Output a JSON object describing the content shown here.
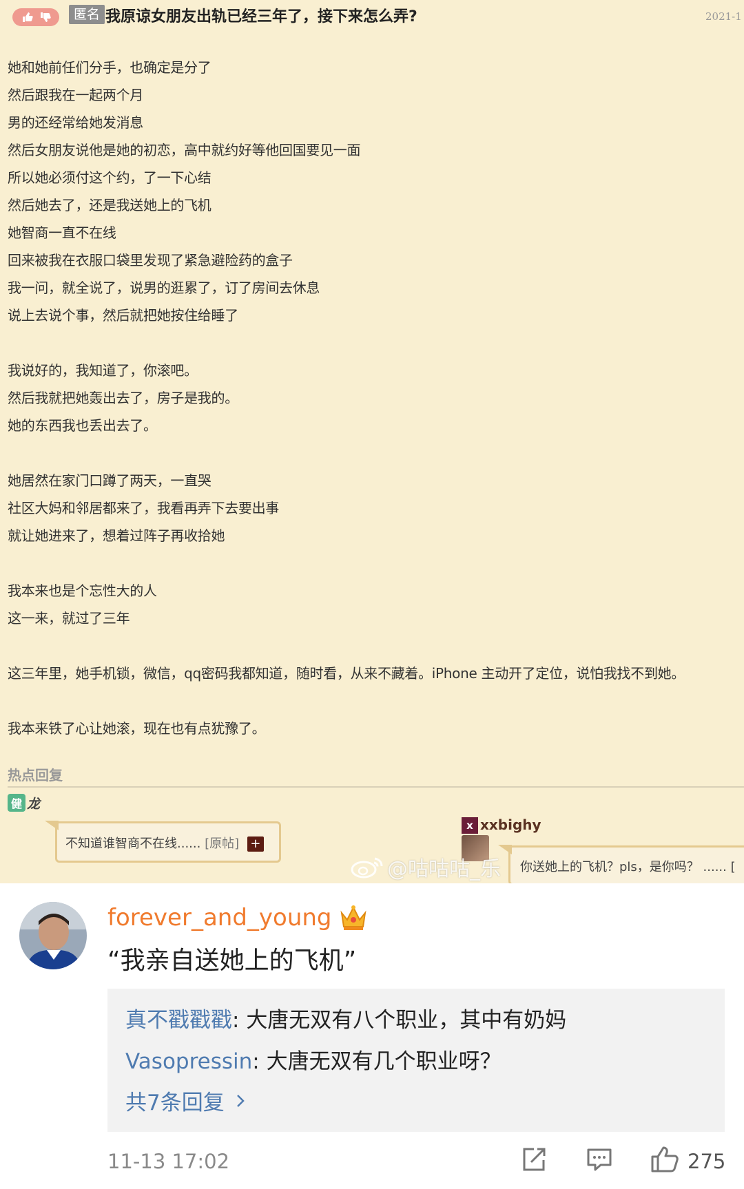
{
  "post": {
    "anon_tag": "匿名",
    "title": "我原谅女朋友出轨已经三年了，接下来怎么弄?",
    "date": "2021-1",
    "lines": [
      "她和她前任们分手，也确定是分了",
      "然后跟我在一起两个月",
      "男的还经常给她发消息",
      "然后女朋友说他是她的初恋，高中就约好等他回国要见一面",
      "所以她必须付这个约，了一下心结",
      "然后她去了，还是我送她上的飞机",
      "她智商一直不在线",
      "回来被我在衣服口袋里发现了紧急避险药的盒子",
      "我一问，就全说了，说男的逛累了，订了房间去休息",
      "说上去说个事，然后就把她按住给睡了",
      "",
      "我说好的，我知道了，你滚吧。",
      "然后我就把她轰出去了，房子是我的。",
      "她的东西我也丢出去了。",
      "",
      "她居然在家门口蹲了两天，一直哭",
      "社区大妈和邻居都来了，我看再弄下去要出事",
      "就让她进来了，想着过阵子再收拾她",
      "",
      "我本来也是个忘性大的人",
      "这一来，就过了三年",
      "",
      "这三年里，她手机锁，微信，qq密码我都知道，随时看，从来不藏着。iPhone 主动开了定位，说怕我找不到她。",
      "",
      "我本来铁了心让她滚，现在也有点犹豫了。"
    ],
    "hot_reply_label": "热点回复",
    "reply1": {
      "badge": "健",
      "user": "龙",
      "text": "不知道谁智商不在线......",
      "source": "[原帖]",
      "plus": "+"
    },
    "reply2": {
      "badge": "x",
      "user": "xxbighy",
      "text": "你送她上的飞机？pls，是你吗？ ...... ["
    },
    "watermark": "@咕咕咕_乐"
  },
  "comment": {
    "username": "forever_and_young",
    "text": "“我亲自送她上的飞机”",
    "replies": [
      {
        "name": "真不戳戳戳",
        "sep": ": ",
        "text": "大唐无双有八个职业，其中有奶妈"
      },
      {
        "name": "Vasopressin",
        "sep": ": ",
        "text": "大唐无双有几个职业呀？"
      }
    ],
    "more_replies": "共7条回复",
    "timestamp": "11-13 17:02",
    "like_count": "275"
  },
  "colors": {
    "forum_bg": "#f9efd1",
    "username_orange": "#f07b2e",
    "reply_name_blue": "#4f7bb0"
  },
  "icons": [
    "thumb-up-icon",
    "thumb-down-icon",
    "weibo-logo-icon",
    "crown-icon",
    "chevron-right-icon",
    "share-icon",
    "comment-icon",
    "like-icon"
  ]
}
